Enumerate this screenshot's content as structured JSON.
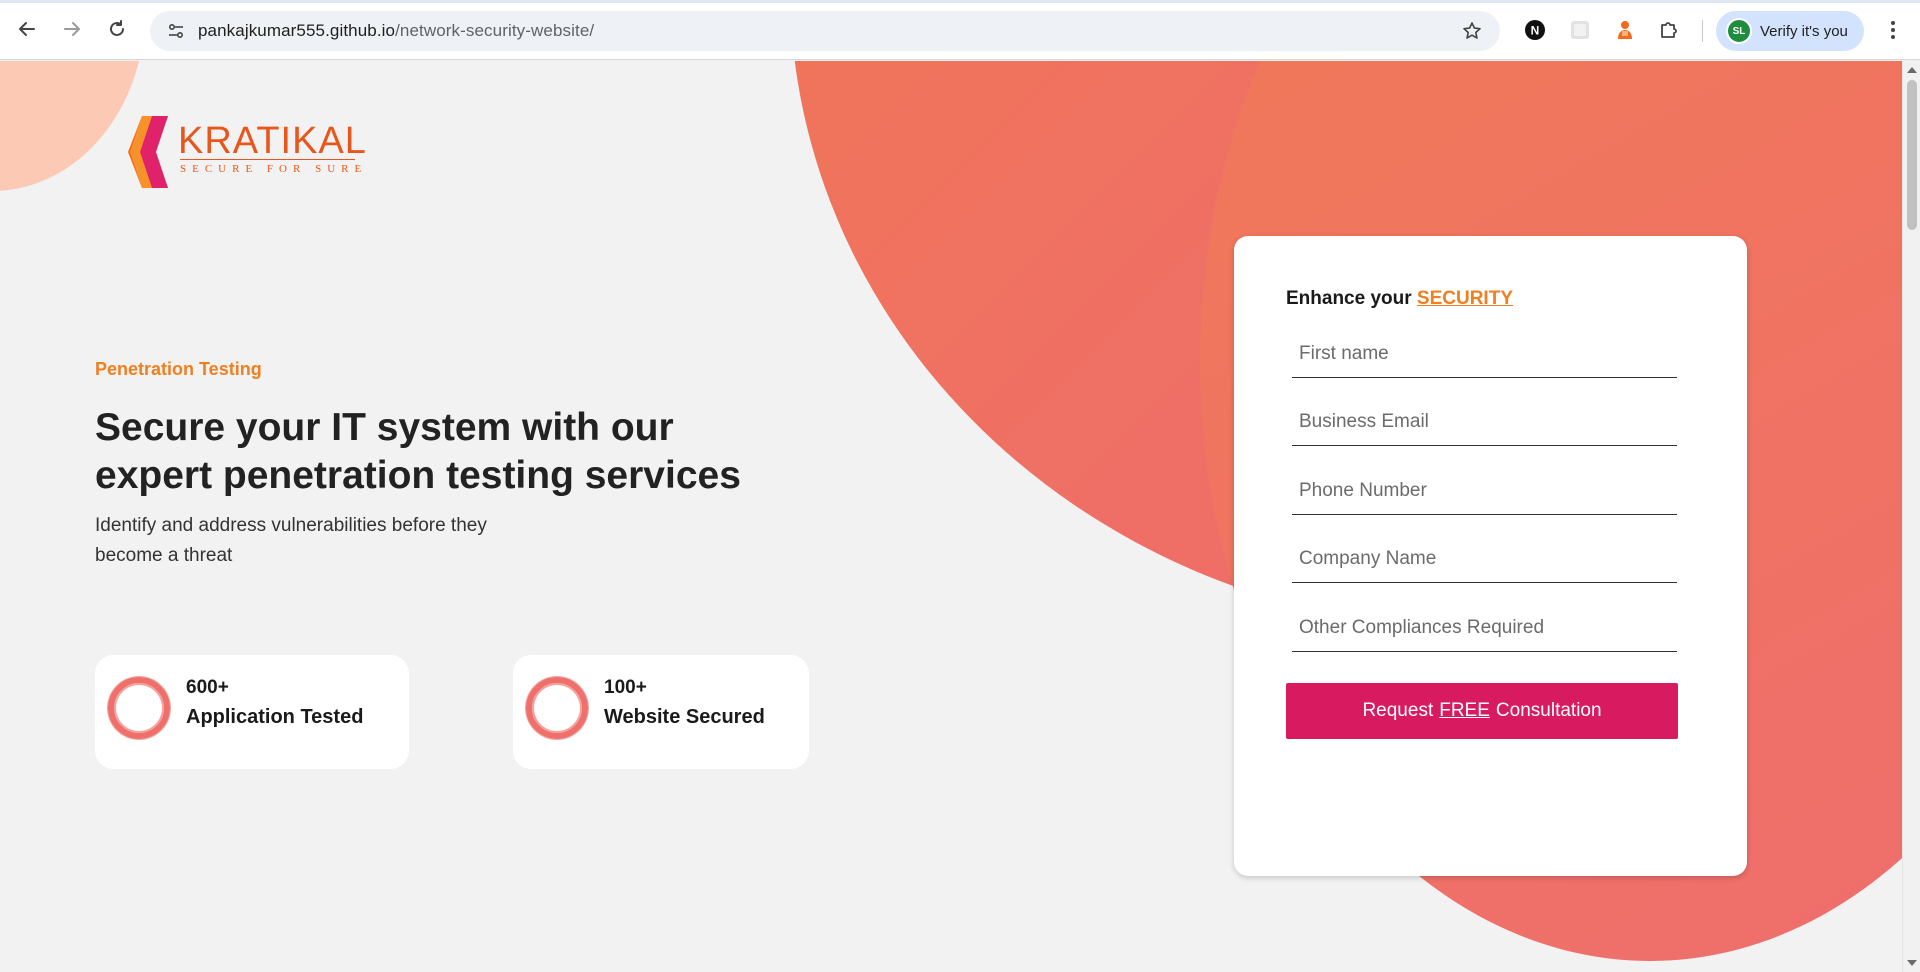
{
  "browser": {
    "url_host": "pankajkumar555.github.io",
    "url_path": "/network-security-website/",
    "profile_button": "Verify it's you",
    "profile_initials": "SL",
    "icons": {
      "back": "arrow-left-icon",
      "forward": "arrow-right-icon",
      "reload": "reload-icon",
      "site_info": "tune-icon",
      "bookmark": "star-icon",
      "extension_n": "n-logo-icon",
      "extension_grey": "grey-square-icon",
      "extension_orange": "orange-figure-icon",
      "extensions": "puzzle-icon",
      "menu": "kebab-menu-icon"
    }
  },
  "logo": {
    "name": "KRATIKAL",
    "tagline": "SECURE FOR SURE"
  },
  "hero": {
    "eyebrow": "Penetration Testing",
    "title": "Secure your IT system with our expert penetration testing services",
    "subtitle": "Identify and address vulnerabilities before they become a threat"
  },
  "stats": [
    {
      "value": "600+",
      "label": "Application Tested"
    },
    {
      "value": "100+",
      "label": "Website Secured"
    }
  ],
  "form": {
    "heading_prefix": "Enhance your ",
    "heading_accent": "SECURITY",
    "fields": {
      "first_name": "First name",
      "business_email": "Business Email",
      "phone": "Phone Number",
      "company": "Company Name",
      "compliances": "Other Compliances Required"
    },
    "submit_prefix": "Request",
    "submit_free": "FREE",
    "submit_suffix": "Consultation"
  },
  "colors": {
    "brand_orange": "#f07f20",
    "blob": "#ef6f66",
    "button": "#d81b60",
    "logo": "#e8561b"
  }
}
